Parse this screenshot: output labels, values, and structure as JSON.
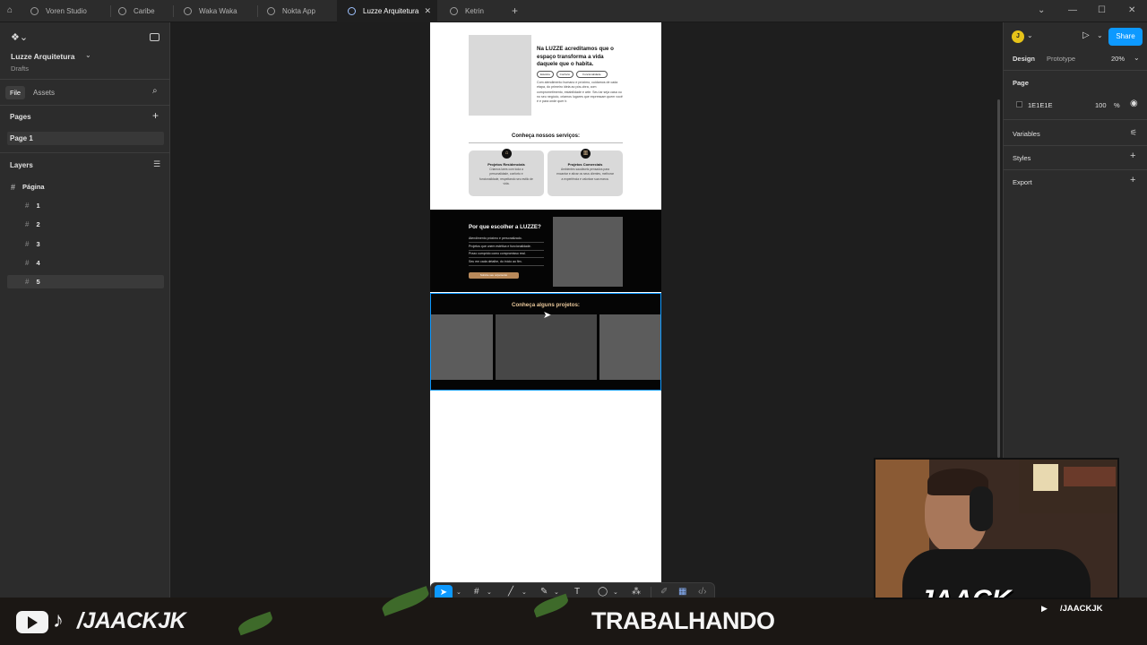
{
  "tabs": [
    {
      "label": "Voren Studio",
      "active": false
    },
    {
      "label": "Caribe",
      "active": false
    },
    {
      "label": "Waka Waka",
      "active": false
    },
    {
      "label": "Nokta App",
      "active": false
    },
    {
      "label": "Luzze Arquitetura",
      "active": true
    },
    {
      "label": "Ketrin",
      "active": false
    }
  ],
  "left": {
    "project_name": "Luzze Arquitetura",
    "project_sub": "Drafts",
    "tab_file": "File",
    "tab_assets": "Assets",
    "pages_header": "Pages",
    "page1": "Page 1",
    "layers_header": "Layers",
    "root_layer": "Página",
    "layers": [
      "1",
      "2",
      "3",
      "4",
      "5"
    ]
  },
  "right": {
    "avatar_initial": "J",
    "share": "Share",
    "tab_design": "Design",
    "tab_prototype": "Prototype",
    "zoom": "20%",
    "page_header": "Page",
    "bg_hex": "1E1E1E",
    "opacity": "100",
    "percent": "%",
    "variables": "Variables",
    "styles": "Styles",
    "export": "Export"
  },
  "design": {
    "about_title": "Na LUZZE acreditamos que o espaço transforma a vida daquele que o habita.",
    "pills": [
      "Estética",
      "Conforto",
      "Funcionalidade"
    ],
    "about_body": "Com atendimento humano e próximo, cuidamos de cada etapa, do primeiro ideia ao pós-obra, com comprometimento, estabilidade e arte. Seu lar seja casa ou no seu negócio, criamos lugares que expressam quem você é e para onde quer ir.",
    "services_title": "Conheça nossos serviços:",
    "card1_title": "Projetos Residenciais",
    "card1_body": "Criamos lares com toda a personalidade, conforto e funcionalidade, respeitando seu estilo de vida.",
    "card2_title": "Projetos Comerciais",
    "card2_body": "Ambientes saudáveis pensados para encantar e ativar os seus clientes, melhorar a experiência e valorizar sua marca.",
    "why_title": "Por que escolher a LUZZE?",
    "why_items": [
      "Atendimento próximo e personalizado.",
      "Projetos que unem estética e funcionalidade.",
      "Prazo cumprido como compromisso real.",
      "Seu em cada detalhe, do início ao fim."
    ],
    "why_button": "Solicite seu orçamento",
    "projects_title": "Conheça alguns projetos:"
  },
  "overlay": {
    "social_handle": "/JAACKJK",
    "status": "TRABALHANDO",
    "logo": "JAACK",
    "small_handle": "/JAACKJK"
  },
  "colors": {
    "accent_blue": "#0d99ff",
    "dark_section": "#050505",
    "gold_text": "#e8c79a",
    "panel": "#2c2c2c",
    "canvas": "#1e1e1e"
  }
}
